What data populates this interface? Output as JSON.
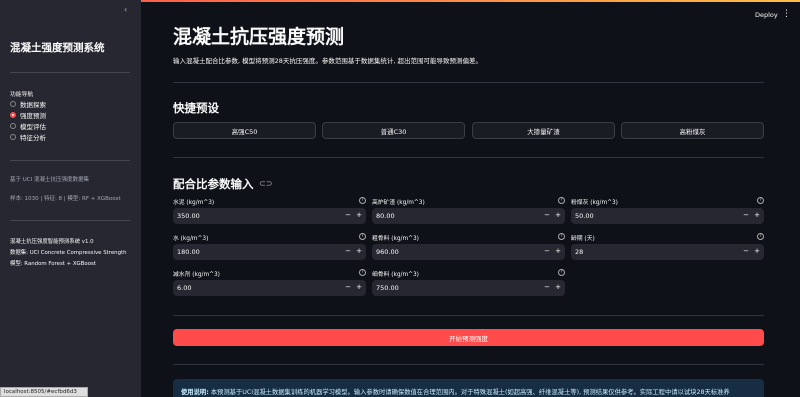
{
  "topbar": {
    "deploy_label": "Deploy",
    "menu_icon": "kebab-menu-icon"
  },
  "sidebar": {
    "collapse_icon": "chevron-left-icon",
    "title": "混凝土强度预测系统",
    "nav_label": "功能导航",
    "nav_items": [
      {
        "label": "数据探索",
        "selected": false
      },
      {
        "label": "强度预测",
        "selected": true
      },
      {
        "label": "模型评估",
        "selected": false
      },
      {
        "label": "特征分析",
        "selected": false
      }
    ],
    "based_on": "基于 UCI 混凝土抗压强度数据集",
    "stats": "样本: 1030 | 特征: 8 | 模型: RF + XGBoost",
    "system_name": "混凝土抗压强度智能预测系统 v1.0",
    "dataset": "数据集: UCI Concrete Compressive Strength",
    "model": "模型: Random Forest + XGBoost"
  },
  "main": {
    "title": "混凝土抗压强度预测",
    "caption": "输入混凝土配合比参数, 模型将预测28天抗压强度。参数范围基于数据集统计, 超出范围可能导致预测偏差。",
    "presets_heading": "快捷预设",
    "presets": [
      "高强C50",
      "普通C30",
      "大掺量矿渣",
      "高粉煤灰"
    ],
    "params_heading": "配合比参数输入",
    "fields": [
      {
        "label": "水泥 (kg/m^3)",
        "value": "350.00"
      },
      {
        "label": "高炉矿渣 (kg/m^3)",
        "value": "80.00"
      },
      {
        "label": "粉煤灰 (kg/m^3)",
        "value": "50.00"
      },
      {
        "label": "水 (kg/m^3)",
        "value": "180.00"
      },
      {
        "label": "粗骨料 (kg/m^3)",
        "value": "960.00"
      },
      {
        "label": "龄期 (天)",
        "value": "28"
      },
      {
        "label": "减水剂 (kg/m^3)",
        "value": "6.00"
      },
      {
        "label": "细骨料 (kg/m^3)",
        "value": "750.00"
      }
    ],
    "stepper_minus": "−",
    "stepper_plus": "+",
    "predict_button": "开始预测强度",
    "info_bold": "使用说明:",
    "info_text": " 本预测基于UCI混凝土数据集训练的机器学习模型。输入参数时请确保数值在合理范围内。对于特殊混凝土(如超高强、纤维混凝土等), 预测结果仅供参考。实际工程中请以试块28天标准养"
  },
  "status_url": "localhost:8505/#ecfbd6d3"
}
